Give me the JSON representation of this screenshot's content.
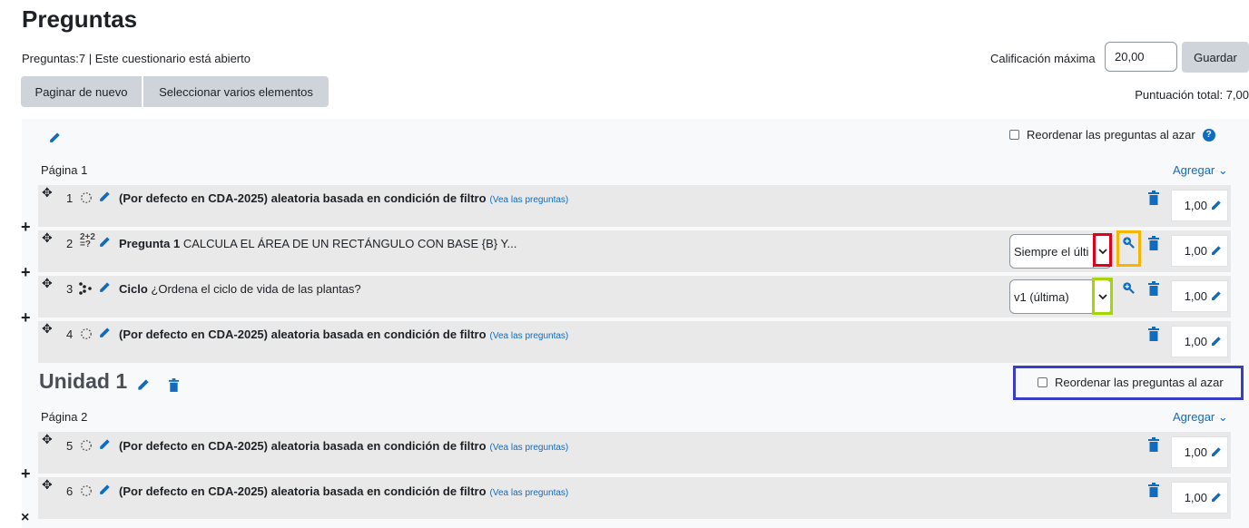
{
  "page": {
    "title": "Preguntas",
    "info": "Preguntas:7 | Este cuestionario está abierto",
    "max_grade_label": "Calificación máxima",
    "max_grade_value": "20,00",
    "save_label": "Guardar",
    "repaginate_label": "Paginar de nuevo",
    "select_multiple_label": "Seleccionar varios elementos",
    "total_label": "Puntuación total: 7,00"
  },
  "section0": {
    "shuffle_label": "Reordenar las preguntas al azar",
    "help_icon": "?"
  },
  "pages": [
    {
      "label": "Página 1",
      "add_label": "Agregar ⌄"
    },
    {
      "label": "Página 2",
      "add_label": "Agregar ⌄"
    }
  ],
  "section1": {
    "title": "Unidad 1",
    "shuffle_label": "Reordenar las preguntas al azar"
  },
  "slots": [
    {
      "num": "1",
      "title": "(Por defecto en CDA-2025) aleatoria basada en condición de filtro",
      "link": "(Vea las preguntas)",
      "mark": "1,00",
      "icon": "random-icon"
    },
    {
      "num": "2",
      "name": "Pregunta 1",
      "text": "CALCULA EL ÁREA DE UN RECTÁNGULO CON BASE {B} Y...",
      "version": "Siempre el últi",
      "mark": "1,00",
      "icon": "calculated-icon"
    },
    {
      "num": "3",
      "name": "Ciclo",
      "text": "¿Ordena el ciclo de vida de las plantas?",
      "version": "v1 (última)",
      "mark": "1,00",
      "icon": "ordering-icon"
    },
    {
      "num": "4",
      "title": "(Por defecto en CDA-2025) aleatoria basada en condición de filtro",
      "link": "(Vea las preguntas)",
      "mark": "1,00",
      "icon": "random-icon"
    },
    {
      "num": "5",
      "title": "(Por defecto en CDA-2025) aleatoria basada en condición de filtro",
      "link": "(Vea las preguntas)",
      "mark": "1,00",
      "icon": "random-icon"
    },
    {
      "num": "6",
      "title": "(Por defecto en CDA-2025) aleatoria basada en condición de filtro",
      "link": "(Vea las preguntas)",
      "mark": "1,00",
      "icon": "random-icon"
    }
  ],
  "symbols": {
    "plus": "+",
    "close": "×",
    "move": "✥"
  },
  "colors": {
    "accent": "#0f6cbf",
    "highlight_red": "#e0001b",
    "highlight_orange": "#f7b500",
    "highlight_lime": "#a6d600",
    "highlight_indigo": "#3a3ec4"
  }
}
